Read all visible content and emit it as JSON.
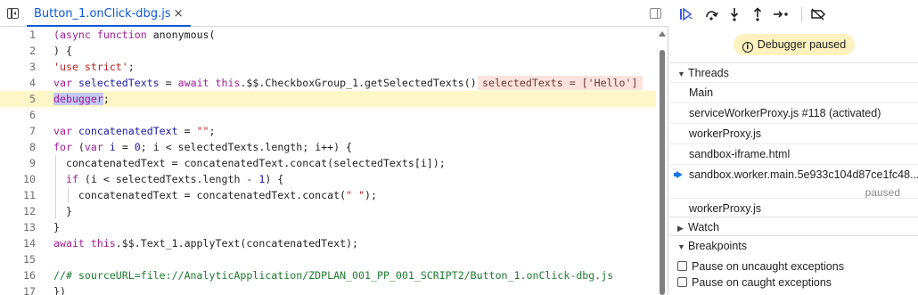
{
  "editor": {
    "tab_label": "Button_1.onClick-dbg.js",
    "tab_close": "×",
    "inline_value": "selectedTexts = ['Hello']",
    "line_numbers": [
      "1",
      "2",
      "3",
      "4",
      "5",
      "6",
      "7",
      "8",
      "9",
      "10",
      "11",
      "12",
      "13",
      "14",
      "15",
      "16",
      "17"
    ]
  },
  "debugger": {
    "paused_text": "Debugger paused",
    "threads_label": "Threads",
    "threads": [
      "Main",
      "serviceWorkerProxy.js #118 (activated)",
      "workerProxy.js",
      "sandbox-iframe.html",
      "sandbox.worker.main.5e933c104d87ce1fc48...",
      "workerProxy.js"
    ],
    "thread_paused_label": "paused",
    "watch_label": "Watch",
    "breakpoints_label": "Breakpoints",
    "pause_uncaught": "Pause on uncaught exceptions",
    "pause_caught": "Pause on caught exceptions"
  },
  "colors": {
    "accent": "#0b57d0",
    "paused_line": "#fff6c8",
    "paused_badge": "#fdf2bf",
    "inline_value_bg": "#fde3dc",
    "keyword": "#a11d95",
    "string": "#ba2121",
    "comment": "#1e7a2e"
  },
  "icons": [
    "sidebar-toggle-icon",
    "close-icon",
    "resume-icon",
    "step-over-icon",
    "step-into-icon",
    "step-out-icon",
    "step-icon",
    "deactivate-breakpoints-icon",
    "info-icon",
    "current-thread-arrow-icon"
  ]
}
